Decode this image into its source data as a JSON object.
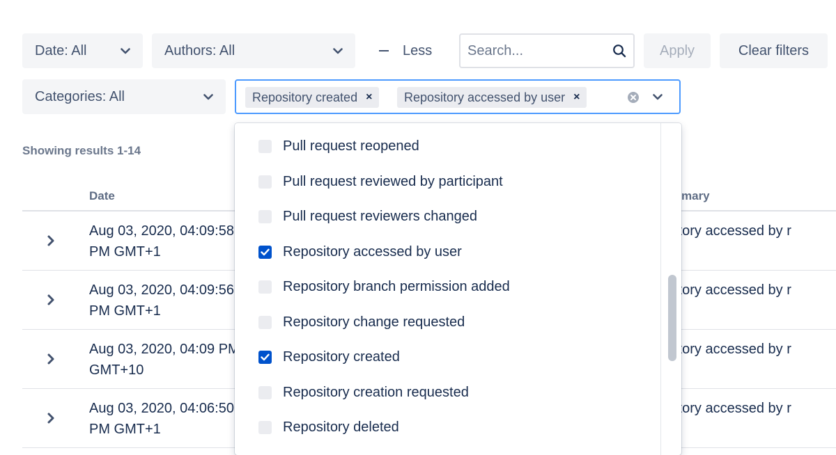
{
  "filters": {
    "date_label": "Date: All",
    "authors_label": "Authors: All",
    "categories_label": "Categories: All",
    "less_label": "Less",
    "search_placeholder": "Search...",
    "apply_label": "Apply",
    "clear_label": "Clear filters"
  },
  "event_select": {
    "selected_tags": [
      {
        "label": "Repository created",
        "remove": "×"
      },
      {
        "label": "Repository accessed by user",
        "remove": "×"
      }
    ],
    "options": [
      {
        "label": "Pull request reopened",
        "checked": false
      },
      {
        "label": "Pull request reviewed by participant",
        "checked": false
      },
      {
        "label": "Pull request reviewers changed",
        "checked": false
      },
      {
        "label": "Repository accessed by user",
        "checked": true
      },
      {
        "label": "Repository branch permission added",
        "checked": false
      },
      {
        "label": "Repository change requested",
        "checked": false
      },
      {
        "label": "Repository created",
        "checked": true
      },
      {
        "label": "Repository creation requested",
        "checked": false
      },
      {
        "label": "Repository deleted",
        "checked": false
      }
    ]
  },
  "results": {
    "count_text": "Showing results 1-14",
    "columns": {
      "date": "Date",
      "summary": "mary"
    },
    "rows": [
      {
        "date": "Aug 03, 2020, 04:09:58 PM GMT+1",
        "summary": "ository accessed by r"
      },
      {
        "date": "Aug 03, 2020, 04:09:56 PM GMT+1",
        "summary": "ository accessed by r"
      },
      {
        "date": "Aug 03, 2020, 04:09 PM GMT+10",
        "summary": "ository accessed by r"
      },
      {
        "date": "Aug 03, 2020, 04:06:50 PM GMT+1",
        "summary": "ository accessed by r"
      }
    ]
  },
  "colors": {
    "accent": "#0052cc",
    "focus_border": "#4c9aff",
    "button_bg": "#f4f5f7"
  }
}
